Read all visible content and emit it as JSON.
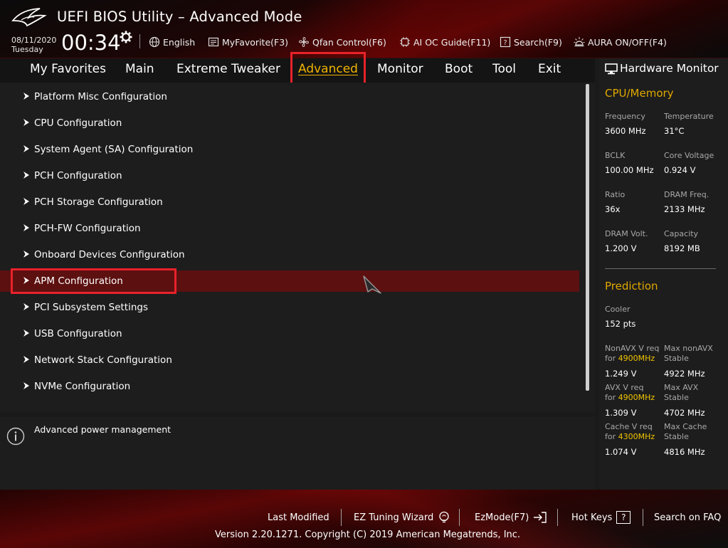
{
  "header": {
    "title": "UEFI BIOS Utility – Advanced Mode",
    "date": "08/11/2020",
    "day": "Tuesday",
    "time": "00:34",
    "toolbar": [
      {
        "label": "English",
        "icon": "globe-icon"
      },
      {
        "label": "MyFavorite(F3)",
        "icon": "favorite-list-icon"
      },
      {
        "label": "Qfan Control(F6)",
        "icon": "fan-icon"
      },
      {
        "label": "AI OC Guide(F11)",
        "icon": "ai-chip-icon"
      },
      {
        "label": "Search(F9)",
        "icon": "search-question-icon"
      },
      {
        "label": "AURA ON/OFF(F4)",
        "icon": "aura-light-icon"
      }
    ]
  },
  "tabs": [
    {
      "label": "My Favorites"
    },
    {
      "label": "Main"
    },
    {
      "label": "Extreme Tweaker"
    },
    {
      "label": "Advanced",
      "active": true
    },
    {
      "label": "Monitor"
    },
    {
      "label": "Boot"
    },
    {
      "label": "Tool"
    },
    {
      "label": "Exit"
    }
  ],
  "menu": [
    {
      "label": "Platform Misc Configuration"
    },
    {
      "label": "CPU Configuration"
    },
    {
      "label": "System Agent (SA) Configuration"
    },
    {
      "label": "PCH Configuration"
    },
    {
      "label": "PCH Storage Configuration"
    },
    {
      "label": "PCH-FW Configuration"
    },
    {
      "label": "Onboard Devices Configuration"
    },
    {
      "label": "APM Configuration",
      "selected": true
    },
    {
      "label": "PCI Subsystem Settings"
    },
    {
      "label": "USB Configuration"
    },
    {
      "label": "Network Stack Configuration"
    },
    {
      "label": "NVMe Configuration"
    }
  ],
  "help": {
    "text": "Advanced power management"
  },
  "hardware_monitor": {
    "title": "Hardware Monitor",
    "cpu_memory": {
      "title": "CPU/Memory",
      "frequency_label": "Frequency",
      "frequency_value": "3600 MHz",
      "temperature_label": "Temperature",
      "temperature_value": "31°C",
      "bclk_label": "BCLK",
      "bclk_value": "100.00 MHz",
      "core_voltage_label": "Core Voltage",
      "core_voltage_value": "0.924 V",
      "ratio_label": "Ratio",
      "ratio_value": "36x",
      "dram_freq_label": "DRAM Freq.",
      "dram_freq_value": "2133 MHz",
      "dram_volt_label": "DRAM Volt.",
      "dram_volt_value": "1.200 V",
      "capacity_label": "Capacity",
      "capacity_value": "8192 MB"
    },
    "prediction": {
      "title": "Prediction",
      "cooler_label": "Cooler",
      "cooler_value": "152 pts",
      "nonavx_req_label": "NonAVX V req",
      "for_label": "for",
      "nonavx_freq": "4900MHz",
      "nonavx_req_value": "1.249 V",
      "max_nonavx_label": "Max nonAVX",
      "stable_label": "Stable",
      "max_nonavx_value": "4922 MHz",
      "avx_req_label": "AVX V req",
      "avx_freq": "4900MHz",
      "avx_req_value": "1.309 V",
      "max_avx_label": "Max AVX",
      "max_avx_value": "4702 MHz",
      "cache_req_label": "Cache V req",
      "cache_freq": "4300MHz",
      "cache_req_value": "1.074 V",
      "max_cache_label": "Max Cache",
      "max_cache_value": "4816 MHz"
    }
  },
  "footer": {
    "last_modified": "Last Modified",
    "ez_tuning": "EZ Tuning Wizard",
    "ez_mode": "EzMode(F7)",
    "hot_keys": "Hot Keys",
    "hot_keys_key": "?",
    "search_faq": "Search on FAQ",
    "copyright": "Version 2.20.1271. Copyright (C) 2019 American Megatrends, Inc."
  },
  "colors": {
    "accent": "#f0b400",
    "highlight_box": "#e8222a",
    "selected_row": "#5c1010"
  }
}
